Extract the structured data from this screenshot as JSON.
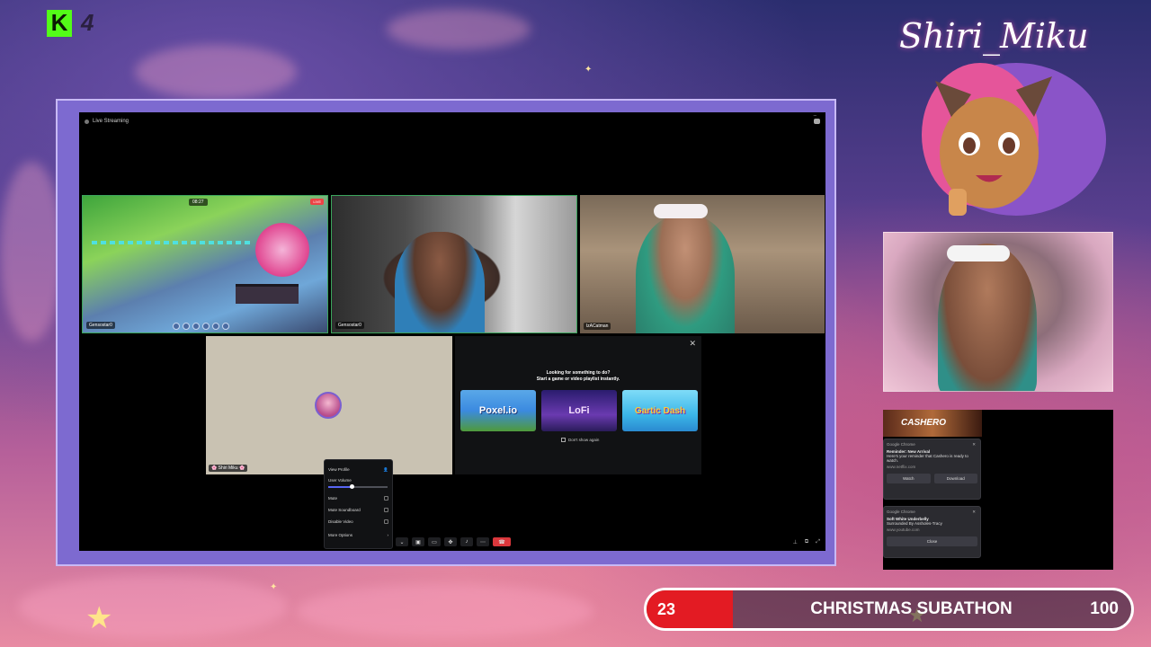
{
  "overlay": {
    "kick_logo": "K",
    "kick_count": "4",
    "streamer_name": "Shiri_Miku"
  },
  "discord": {
    "title": "Live Streaming",
    "tiles": [
      {
        "label": "Gensostar0",
        "hud_time": "08:27",
        "badge": "LIVE"
      },
      {
        "label": "Gensostar0"
      },
      {
        "label": "lzACatman"
      }
    ],
    "self_tile": {
      "label": "🌸 Shiri Miku 🌸"
    },
    "activity": {
      "title_line1": "Looking for something to do?",
      "title_line2": "Start a game or video playlist instantly.",
      "cards": [
        {
          "name": "Poxel.io"
        },
        {
          "name": "LoFi"
        },
        {
          "name": "Gartic Dash"
        }
      ],
      "dont_show": "Don't show again"
    },
    "context_menu": {
      "view_profile": "View Profile",
      "user_volume": "User Volume",
      "volume_level": 0.4,
      "mute": "Mute",
      "mute_soundboard": "Mute Soundboard",
      "disable_video": "Disable Video",
      "more_options": "More Options"
    }
  },
  "notifications": {
    "banner": "CASHERO",
    "toasts": [
      {
        "app": "Google Chrome",
        "title": "Reminder: New Arrival",
        "body": "Here's your reminder that Cashero is ready to watch.",
        "url": "www.netflix.com",
        "buttons": [
          "Watch",
          "Download"
        ]
      },
      {
        "app": "Google Chrome",
        "title": "Soft White Underbelly",
        "body": "Surrounded By Assholes-Tracy",
        "url": "www.youtube.com",
        "buttons": [
          "Close"
        ]
      }
    ]
  },
  "subathon": {
    "count": "23",
    "title": "CHRISTMAS SUBATHON",
    "goal": "100",
    "progress": 0.23
  },
  "colors": {
    "kick_green": "#53fc18",
    "discord_bg": "#000000",
    "frame_purple": "#7d6ad0",
    "subathon_red": "#e31b23"
  }
}
